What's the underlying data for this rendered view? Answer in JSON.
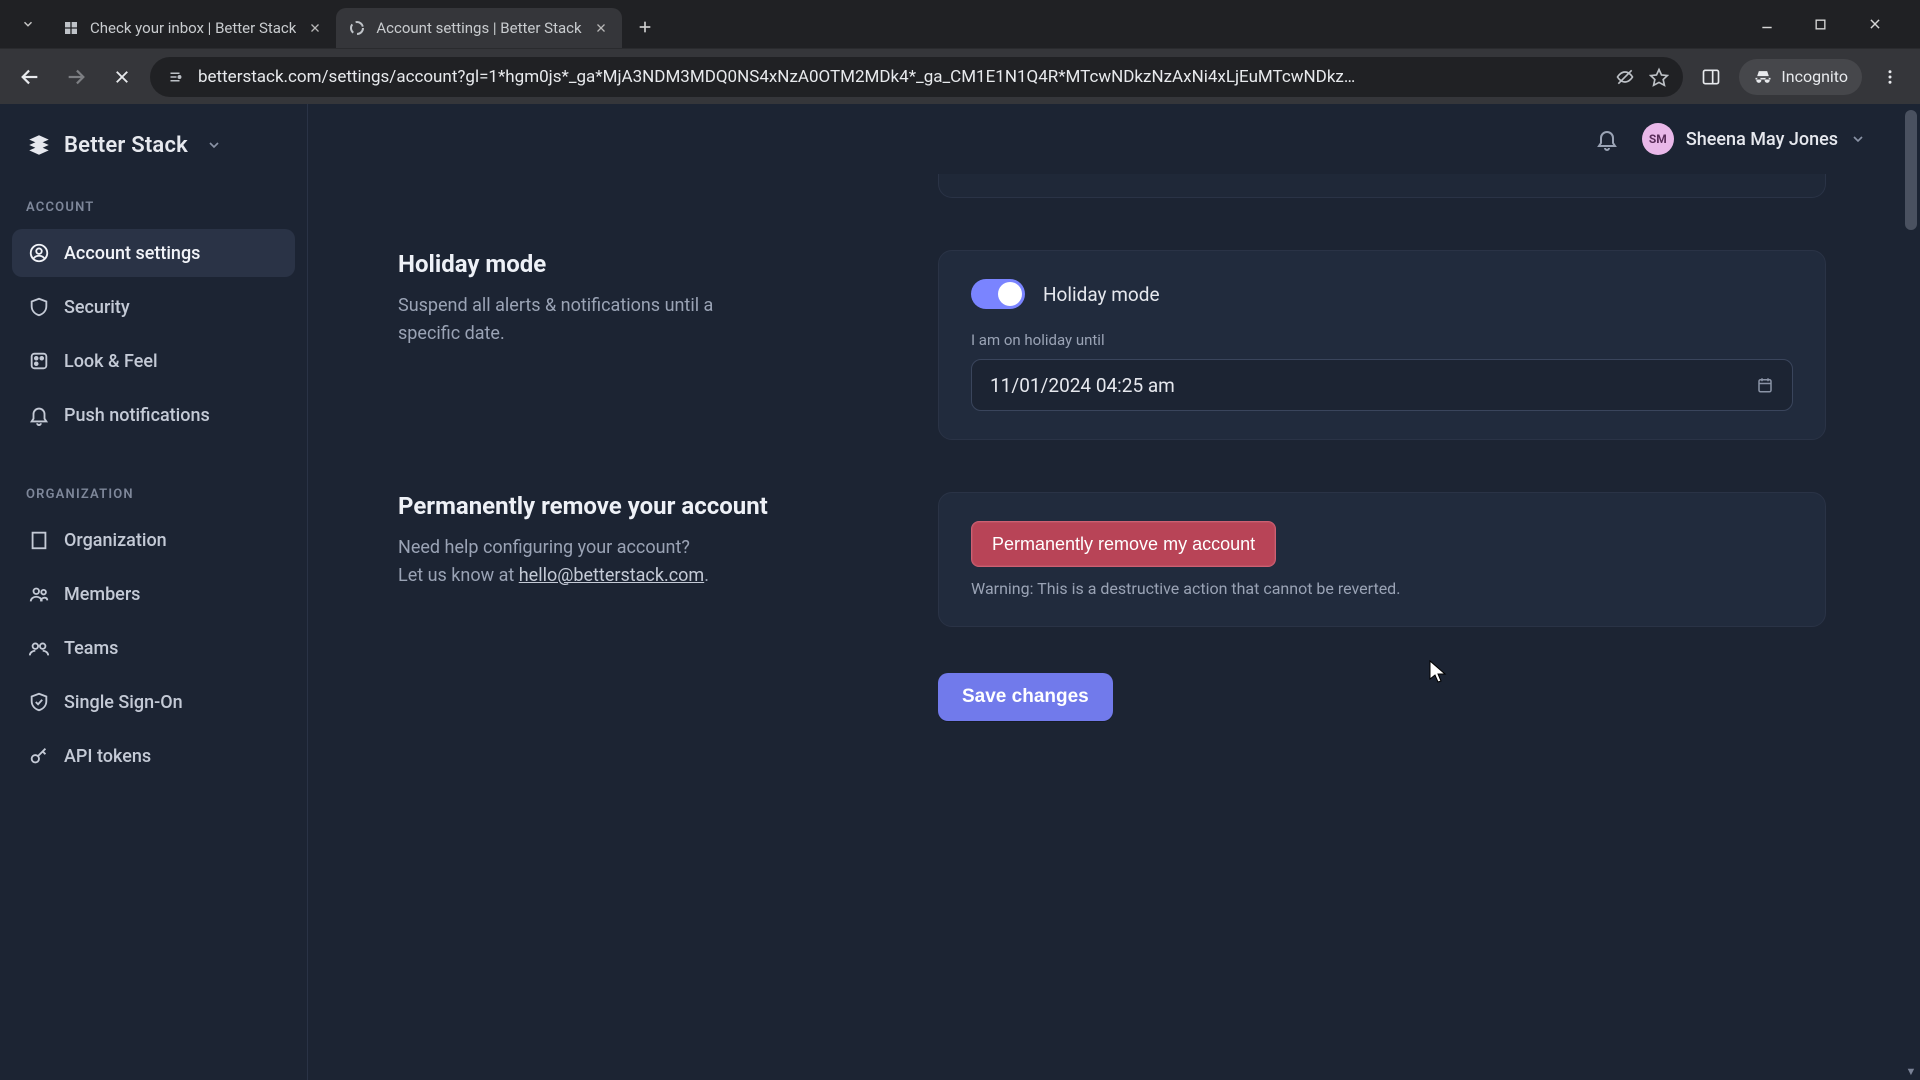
{
  "browser": {
    "tabs": [
      {
        "title": "Check your inbox | Better Stack",
        "active": false
      },
      {
        "title": "Account settings | Better Stack",
        "active": true
      }
    ],
    "url": "betterstack.com/settings/account?gl=1*hgm0js*_ga*MjA3NDM3MDQ0NS4xNzA0OTM2MDk4*_ga_CM1E1N1Q4R*MTcwNDkzNzAxNi4xLjEuMTcwNDkz…",
    "incognito_label": "Incognito"
  },
  "app": {
    "brand": "Better Stack",
    "user": {
      "name": "Sheena May Jones",
      "initials": "SM"
    },
    "sidebar": {
      "sections": [
        {
          "label": "ACCOUNT",
          "items": [
            {
              "id": "account-settings",
              "label": "Account settings",
              "active": true
            },
            {
              "id": "security",
              "label": "Security"
            },
            {
              "id": "look-feel",
              "label": "Look & Feel"
            },
            {
              "id": "push",
              "label": "Push notifications"
            }
          ]
        },
        {
          "label": "ORGANIZATION",
          "items": [
            {
              "id": "organization",
              "label": "Organization"
            },
            {
              "id": "members",
              "label": "Members"
            },
            {
              "id": "teams",
              "label": "Teams"
            },
            {
              "id": "sso",
              "label": "Single Sign-On"
            },
            {
              "id": "api-tokens",
              "label": "API tokens"
            }
          ]
        }
      ]
    },
    "settings": {
      "holiday": {
        "title": "Holiday mode",
        "desc": "Suspend all alerts & notifications until a specific date.",
        "toggle_label": "Holiday mode",
        "toggle_on": true,
        "date_field_label": "I am on holiday until",
        "date_value": "11/01/2024  04:25  am"
      },
      "remove": {
        "title": "Permanently remove your account",
        "desc_prefix": "Need help configuring your account?",
        "desc_line2_prefix": "Let us know at ",
        "desc_email": "hello@betterstack.com",
        "desc_suffix": ".",
        "button_label": "Permanently remove my account",
        "warning": "Warning: This is a destructive action that cannot be reverted."
      },
      "save_label": "Save changes"
    }
  }
}
